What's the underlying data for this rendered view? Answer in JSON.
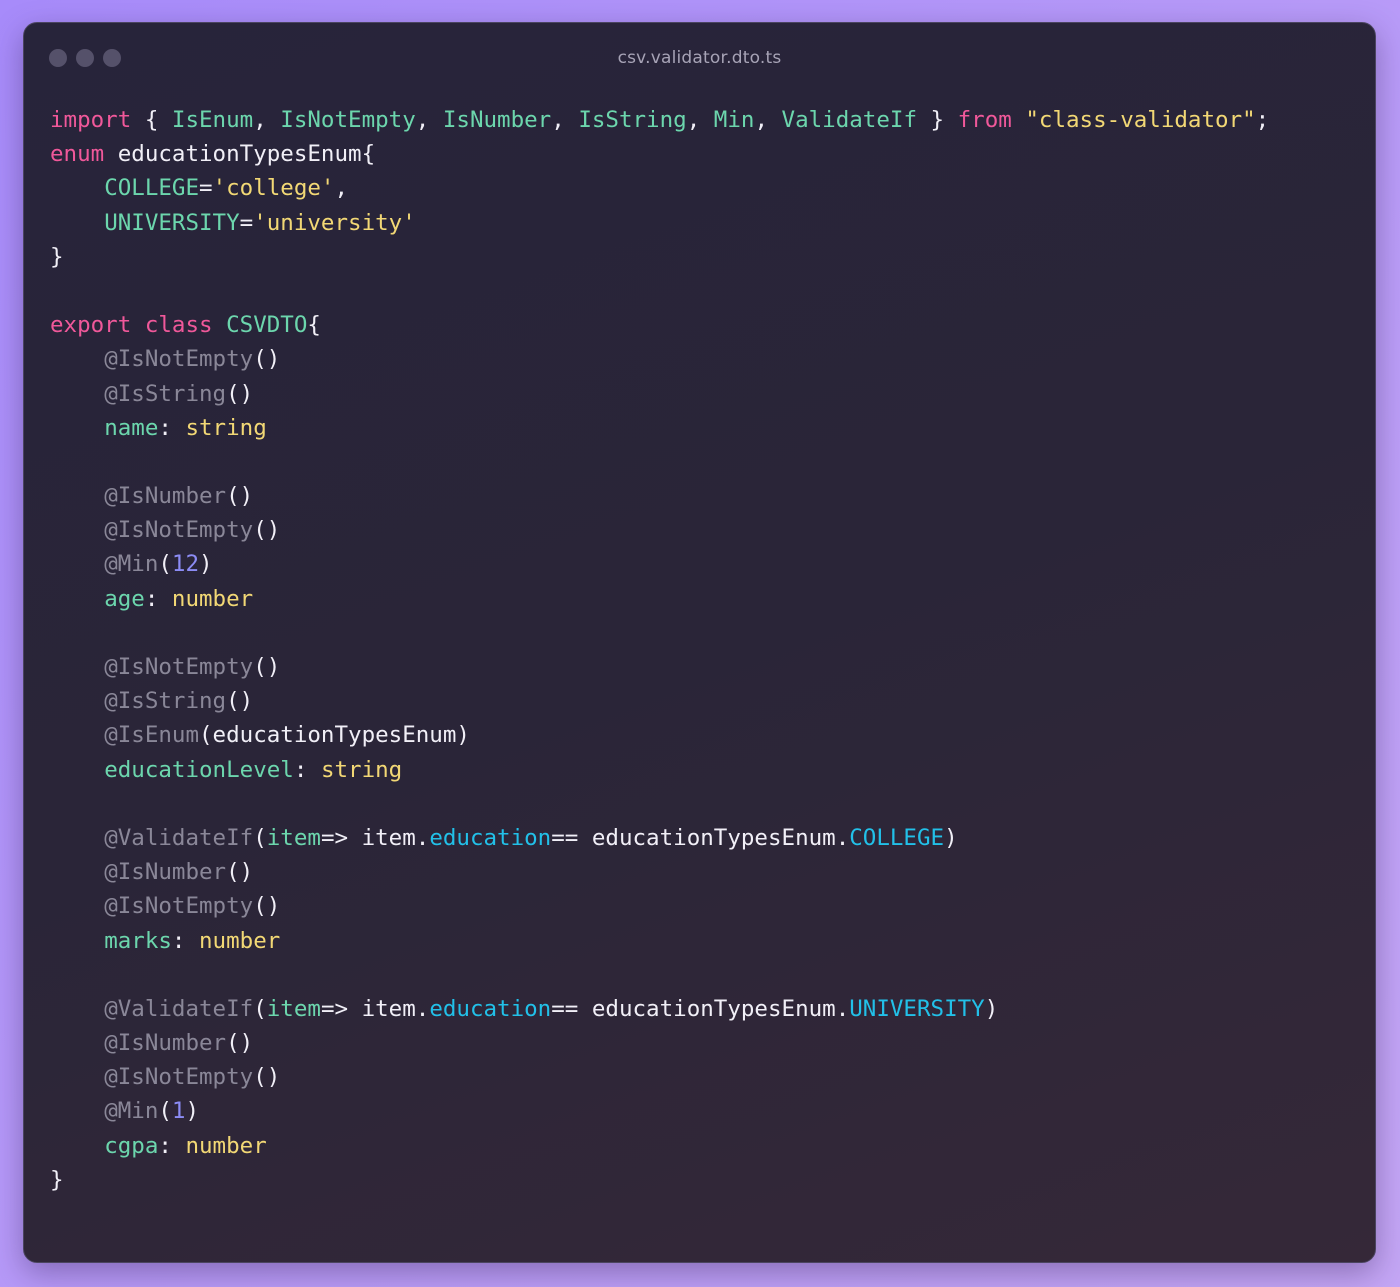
{
  "window": {
    "title": "csv.validator.dto.ts"
  },
  "code_lines": [
    [
      [
        "kw",
        "import"
      ],
      [
        "plain",
        " { "
      ],
      [
        "id",
        "IsEnum"
      ],
      [
        "plain",
        ", "
      ],
      [
        "id",
        "IsNotEmpty"
      ],
      [
        "plain",
        ", "
      ],
      [
        "id",
        "IsNumber"
      ],
      [
        "plain",
        ", "
      ],
      [
        "id",
        "IsString"
      ],
      [
        "plain",
        ", "
      ],
      [
        "id",
        "Min"
      ],
      [
        "plain",
        ", "
      ],
      [
        "id",
        "ValidateIf"
      ],
      [
        "plain",
        " } "
      ],
      [
        "kw",
        "from"
      ],
      [
        "plain",
        " "
      ],
      [
        "str",
        "\"class-validator\""
      ],
      [
        "plain",
        ";"
      ]
    ],
    [
      [
        "kw",
        "enum"
      ],
      [
        "plain",
        " educationTypesEnum{"
      ]
    ],
    [
      [
        "plain",
        "    "
      ],
      [
        "id",
        "COLLEGE"
      ],
      [
        "plain",
        "="
      ],
      [
        "str",
        "'college'"
      ],
      [
        "plain",
        ","
      ]
    ],
    [
      [
        "plain",
        "    "
      ],
      [
        "id",
        "UNIVERSITY"
      ],
      [
        "plain",
        "="
      ],
      [
        "str",
        "'university'"
      ]
    ],
    [
      [
        "plain",
        "}"
      ]
    ],
    [],
    [
      [
        "kw",
        "export"
      ],
      [
        "plain",
        " "
      ],
      [
        "kw",
        "class"
      ],
      [
        "plain",
        " "
      ],
      [
        "id",
        "CSVDTO"
      ],
      [
        "plain",
        "{"
      ]
    ],
    [
      [
        "plain",
        "    "
      ],
      [
        "dec",
        "@IsNotEmpty"
      ],
      [
        "plain",
        "()"
      ]
    ],
    [
      [
        "plain",
        "    "
      ],
      [
        "dec",
        "@IsString"
      ],
      [
        "plain",
        "()"
      ]
    ],
    [
      [
        "plain",
        "    "
      ],
      [
        "id",
        "name"
      ],
      [
        "plain",
        ": "
      ],
      [
        "type",
        "string"
      ]
    ],
    [],
    [
      [
        "plain",
        "    "
      ],
      [
        "dec",
        "@IsNumber"
      ],
      [
        "plain",
        "()"
      ]
    ],
    [
      [
        "plain",
        "    "
      ],
      [
        "dec",
        "@IsNotEmpty"
      ],
      [
        "plain",
        "()"
      ]
    ],
    [
      [
        "plain",
        "    "
      ],
      [
        "dec",
        "@Min"
      ],
      [
        "plain",
        "("
      ],
      [
        "num",
        "12"
      ],
      [
        "plain",
        ")"
      ]
    ],
    [
      [
        "plain",
        "    "
      ],
      [
        "id",
        "age"
      ],
      [
        "plain",
        ": "
      ],
      [
        "type",
        "number"
      ]
    ],
    [],
    [
      [
        "plain",
        "    "
      ],
      [
        "dec",
        "@IsNotEmpty"
      ],
      [
        "plain",
        "()"
      ]
    ],
    [
      [
        "plain",
        "    "
      ],
      [
        "dec",
        "@IsString"
      ],
      [
        "plain",
        "()"
      ]
    ],
    [
      [
        "plain",
        "    "
      ],
      [
        "dec",
        "@IsEnum"
      ],
      [
        "plain",
        "(educationTypesEnum)"
      ]
    ],
    [
      [
        "plain",
        "    "
      ],
      [
        "id",
        "educationLevel"
      ],
      [
        "plain",
        ": "
      ],
      [
        "type",
        "string"
      ]
    ],
    [],
    [
      [
        "plain",
        "    "
      ],
      [
        "dec",
        "@ValidateIf"
      ],
      [
        "plain",
        "("
      ],
      [
        "id",
        "item"
      ],
      [
        "plain",
        "=> item."
      ],
      [
        "prop",
        "education"
      ],
      [
        "plain",
        "== educationTypesEnum."
      ],
      [
        "prop",
        "COLLEGE"
      ],
      [
        "plain",
        ")"
      ]
    ],
    [
      [
        "plain",
        "    "
      ],
      [
        "dec",
        "@IsNumber"
      ],
      [
        "plain",
        "()"
      ]
    ],
    [
      [
        "plain",
        "    "
      ],
      [
        "dec",
        "@IsNotEmpty"
      ],
      [
        "plain",
        "()"
      ]
    ],
    [
      [
        "plain",
        "    "
      ],
      [
        "id",
        "marks"
      ],
      [
        "plain",
        ": "
      ],
      [
        "type",
        "number"
      ]
    ],
    [],
    [
      [
        "plain",
        "    "
      ],
      [
        "dec",
        "@ValidateIf"
      ],
      [
        "plain",
        "("
      ],
      [
        "id",
        "item"
      ],
      [
        "plain",
        "=> item."
      ],
      [
        "prop",
        "education"
      ],
      [
        "plain",
        "== educationTypesEnum."
      ],
      [
        "prop",
        "UNIVERSITY"
      ],
      [
        "plain",
        ")"
      ]
    ],
    [
      [
        "plain",
        "    "
      ],
      [
        "dec",
        "@IsNumber"
      ],
      [
        "plain",
        "()"
      ]
    ],
    [
      [
        "plain",
        "    "
      ],
      [
        "dec",
        "@IsNotEmpty"
      ],
      [
        "plain",
        "()"
      ]
    ],
    [
      [
        "plain",
        "    "
      ],
      [
        "dec",
        "@Min"
      ],
      [
        "plain",
        "("
      ],
      [
        "num",
        "1"
      ],
      [
        "plain",
        ")"
      ]
    ],
    [
      [
        "plain",
        "    "
      ],
      [
        "id",
        "cgpa"
      ],
      [
        "plain",
        ": "
      ],
      [
        "type",
        "number"
      ]
    ],
    [
      [
        "plain",
        "}"
      ]
    ]
  ]
}
